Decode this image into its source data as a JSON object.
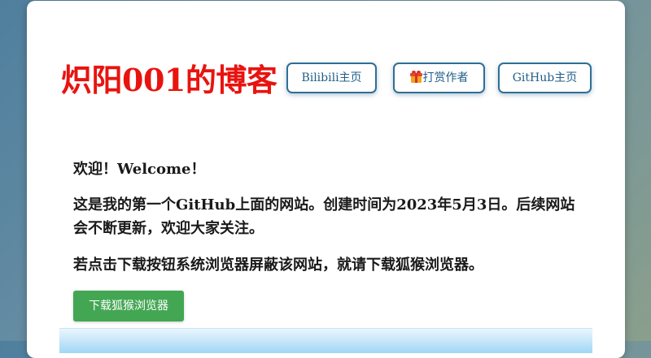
{
  "header": {
    "site_title": "炽阳001的博客",
    "nav": {
      "bilibili_label": "Bilibili主页",
      "reward_label": "打赏作者",
      "reward_icon": "gift-icon",
      "github_label": "GitHub主页"
    }
  },
  "main": {
    "welcome": "欢迎！Welcome！",
    "intro": "这是我的第一个GitHub上面的网站。创建时间为2023年5月3日。后续网站会不断更新，欢迎大家关注。",
    "tip": "若点击下载按钮系统浏览器屏蔽该网站，就请下载狐猴浏览器。",
    "download_button_label": "下载狐猴浏览器"
  },
  "colors": {
    "title": "#e8130f",
    "nav_border": "#2f6f95",
    "download_button": "#43a653"
  }
}
